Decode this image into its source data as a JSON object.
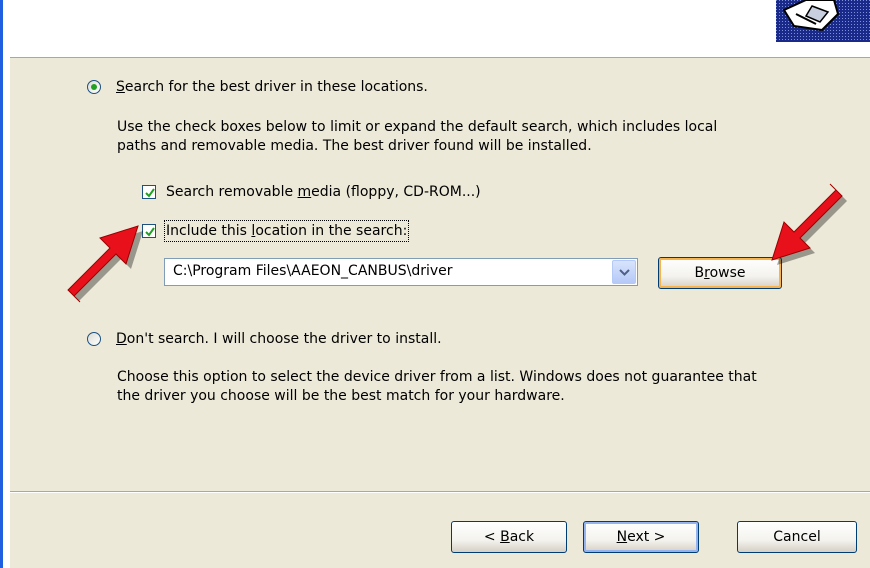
{
  "search_option": {
    "label_prefix": "",
    "label_mnemonic": "S",
    "label_rest": "earch for the best driver in these locations.",
    "description_line1": "Use the check boxes below to limit or expand the default search, which includes local",
    "description_line2": "paths and removable media. The best driver found will be installed.",
    "selected": true
  },
  "removable_media_checkbox": {
    "label_before": "Search removable ",
    "label_mnemonic": "m",
    "label_after": "edia (floppy, CD-ROM...)",
    "checked": true
  },
  "include_location_checkbox": {
    "label_before": "Include this ",
    "label_mnemonic": "l",
    "label_after": "ocation in the search:",
    "checked": true
  },
  "location_combo": {
    "value": "C:\\Program Files\\AAEON_CANBUS\\driver"
  },
  "browse_button": {
    "label_before": "B",
    "label_mnemonic": "r",
    "label_after": "owse"
  },
  "dont_search_option": {
    "label_mnemonic": "D",
    "label_rest": "on't search. I will choose the driver to install.",
    "description_line1": "Choose this option to select the device driver from a list.  Windows does not guarantee that",
    "description_line2": "the driver you choose will be the best match for your hardware.",
    "selected": false
  },
  "footer": {
    "back_prefix": "< ",
    "back_mnemonic": "B",
    "back_rest": "ack",
    "next_mnemonic": "N",
    "next_rest": "ext >",
    "cancel_label": "Cancel"
  },
  "colors": {
    "dialog_bg": "#ece9d8",
    "accent_blue": "#1f5fe0",
    "arrow_red": "#e8101a",
    "check_green": "#21a121"
  },
  "icons": [
    "wizard-hardware-icon",
    "radio-selected-icon",
    "radio-unselected-icon",
    "checkbox-checked-icon",
    "dropdown-chevron-icon",
    "red-arrow-annotation"
  ]
}
